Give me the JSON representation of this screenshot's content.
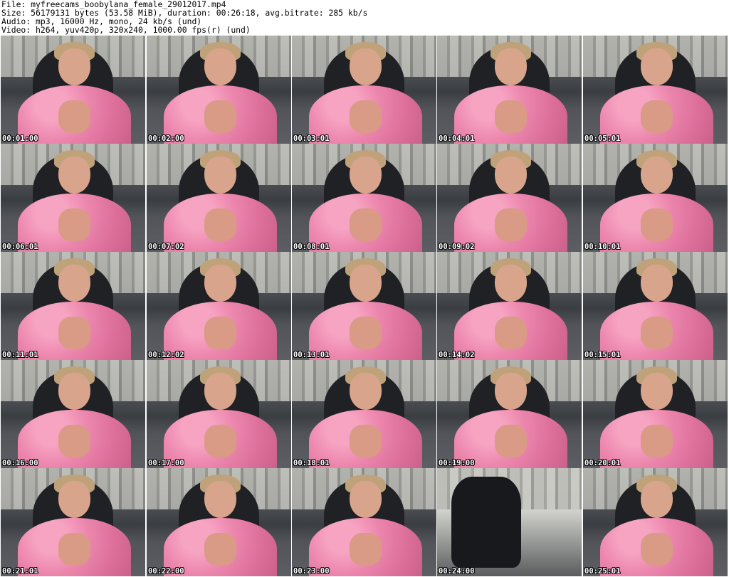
{
  "header": {
    "file": "File: myfreecams_boobylana_female_29012017.mp4",
    "size": "Size: 56179131 bytes (53.58 MiB), duration: 00:26:18, avg.bitrate: 285 kb/s",
    "audio": "Audio: mp3, 16000 Hz, mono, 24 kb/s (und)",
    "video": "Video: h264, yuv420p, 320x240, 1000.00 fps(r) (und)"
  },
  "thumbnails": [
    {
      "time": "00:01:00",
      "empty": false
    },
    {
      "time": "00:02:00",
      "empty": false
    },
    {
      "time": "00:03:01",
      "empty": false
    },
    {
      "time": "00:04:01",
      "empty": false
    },
    {
      "time": "00:05:01",
      "empty": false
    },
    {
      "time": "00:06:01",
      "empty": false
    },
    {
      "time": "00:07:02",
      "empty": false
    },
    {
      "time": "00:08:01",
      "empty": false
    },
    {
      "time": "00:09:02",
      "empty": false
    },
    {
      "time": "00:10:01",
      "empty": false
    },
    {
      "time": "00:11:01",
      "empty": false
    },
    {
      "time": "00:12:02",
      "empty": false
    },
    {
      "time": "00:13:01",
      "empty": false
    },
    {
      "time": "00:14:02",
      "empty": false
    },
    {
      "time": "00:15:01",
      "empty": false
    },
    {
      "time": "00:16:00",
      "empty": false
    },
    {
      "time": "00:17:00",
      "empty": false
    },
    {
      "time": "00:18:01",
      "empty": false
    },
    {
      "time": "00:19:00",
      "empty": false
    },
    {
      "time": "00:20:01",
      "empty": false
    },
    {
      "time": "00:21:01",
      "empty": false
    },
    {
      "time": "00:22:00",
      "empty": false
    },
    {
      "time": "00:23:00",
      "empty": false
    },
    {
      "time": "00:24:00",
      "empty": true
    },
    {
      "time": "00:25:01",
      "empty": false
    }
  ]
}
